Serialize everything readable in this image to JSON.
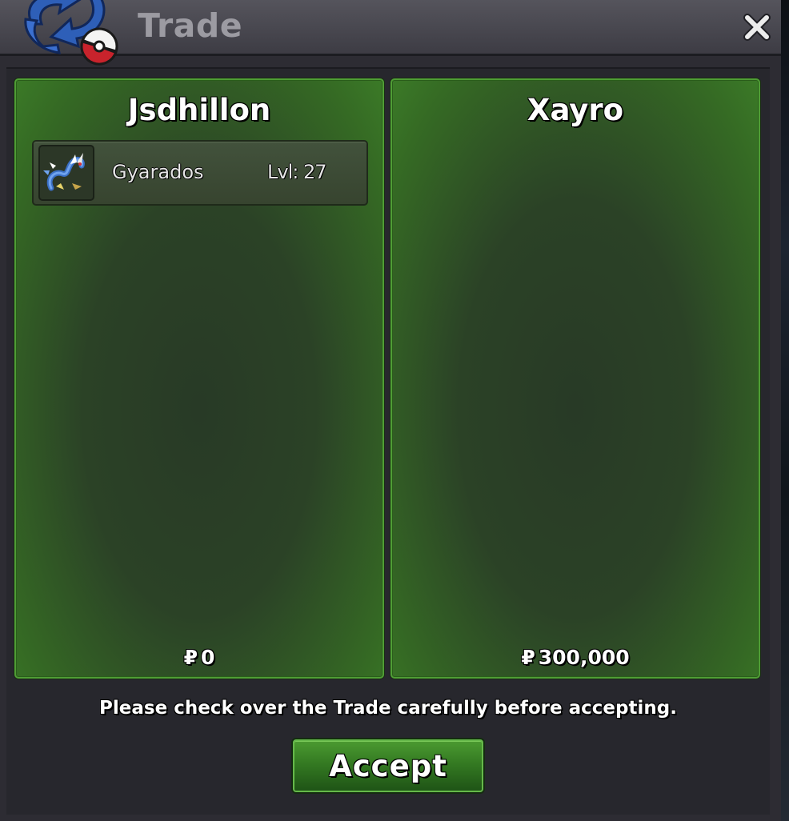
{
  "window": {
    "title": "Trade",
    "logo_icon": "trade-swap-pokeball-icon",
    "close_icon": "close-icon"
  },
  "offers": [
    {
      "player": "Jsdhillon",
      "pokemon": [
        {
          "name": "Gyarados",
          "level": "Lvl: 27",
          "sprite_icon": "gyarados-sprite-icon"
        }
      ],
      "currency_symbol": "₽",
      "money": "0"
    },
    {
      "player": "Xayro",
      "pokemon": [],
      "currency_symbol": "₽",
      "money": "300,000"
    }
  ],
  "notice": "Please check over the Trade carefully before accepting.",
  "accept_label": "Accept",
  "colors": {
    "panel_border": "#4f9d35",
    "panel_fill": "#2b4226",
    "accept_button": "#347a22",
    "title_text": "#9c9ba2"
  }
}
